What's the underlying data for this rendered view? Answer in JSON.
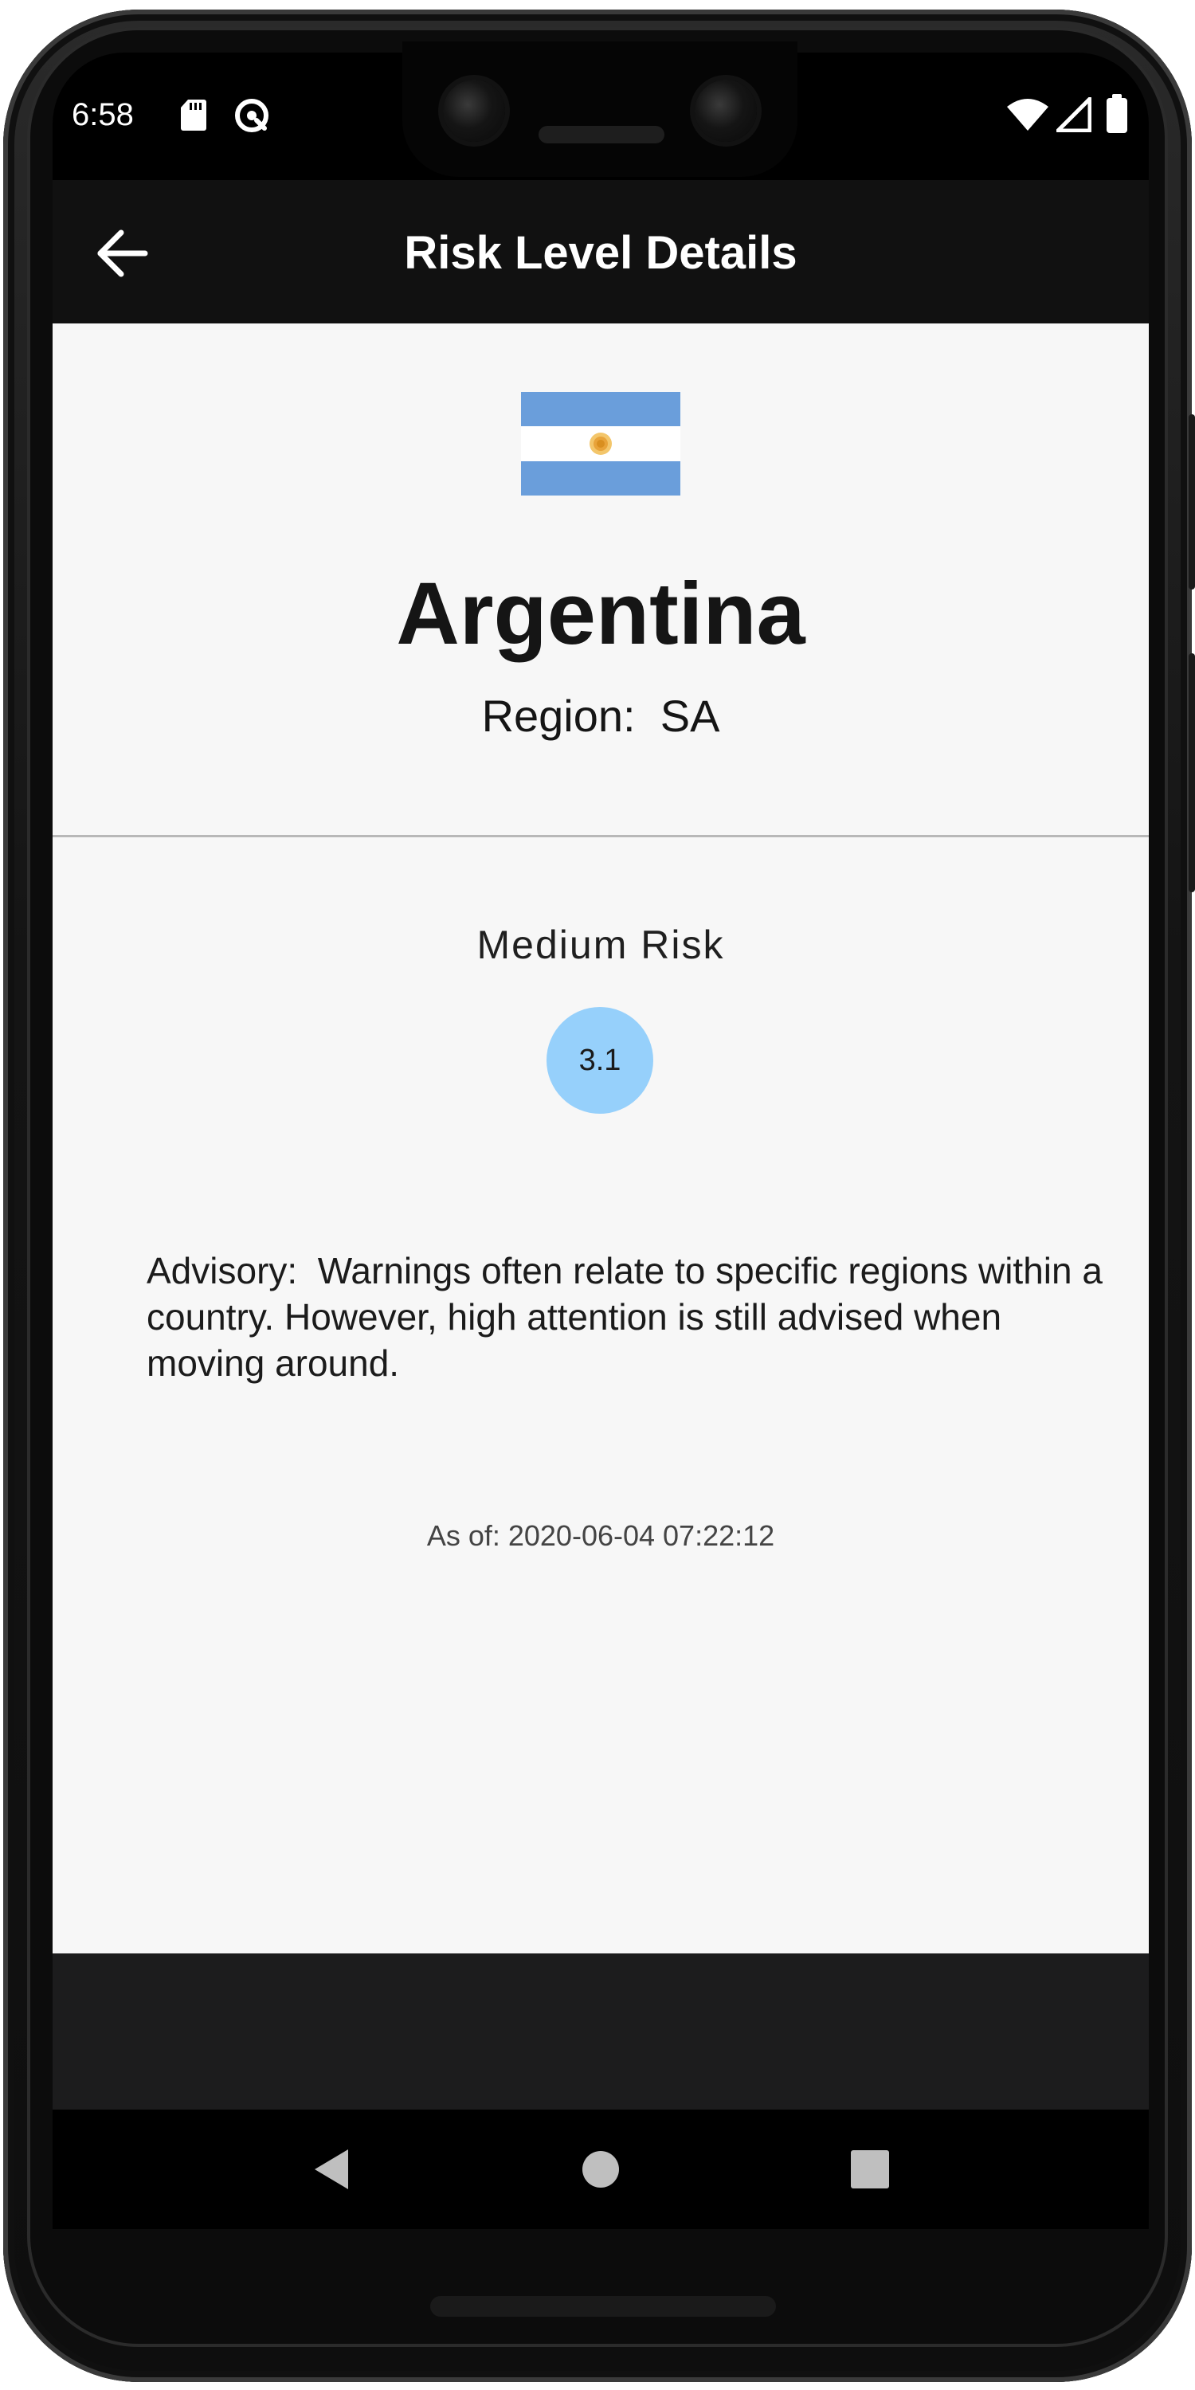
{
  "status_bar": {
    "time": "6:58",
    "left_icons": [
      "sd-card-icon",
      "data-saver-icon"
    ],
    "right_icons": [
      "wifi-icon",
      "signal-icon",
      "battery-icon"
    ]
  },
  "app_bar": {
    "title": "Risk Level Details",
    "back_icon": "arrow-back-icon"
  },
  "country": {
    "flag": "argentina-flag",
    "flag_colors": {
      "blue": "#6a9edb",
      "white": "#ffffff",
      "sun": "#e8a33a"
    },
    "name": "Argentina",
    "region_text": "Region:  SA"
  },
  "risk": {
    "label": "Medium Risk",
    "score": "3.1",
    "circle_color": "#96d0fb"
  },
  "advisory": {
    "text": "Advisory:  Warnings often relate to specific regions within a country. However, high attention is still advised when moving around."
  },
  "as_of": {
    "text": "As of: 2020-06-04 07:22:12"
  },
  "nav_bar": {
    "buttons": [
      "back-triangle-icon",
      "home-circle-icon",
      "recents-square-icon"
    ]
  }
}
